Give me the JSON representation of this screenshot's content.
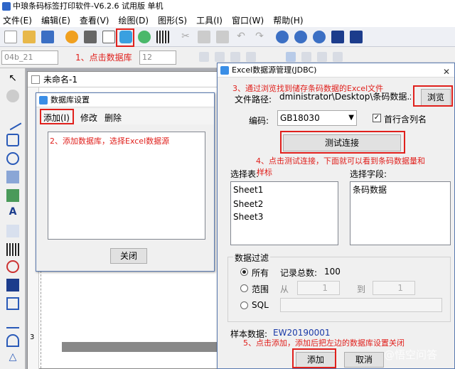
{
  "window": {
    "title": "中琅条码标签打印软件-V6.2.6 试用版 单机"
  },
  "menu": [
    "文件(E)",
    "编辑(E)",
    "查看(V)",
    "绘图(D)",
    "图形(S)",
    "工具(I)",
    "窗口(W)",
    "帮助(H)"
  ],
  "fontbar": {
    "font_name": "04b_21",
    "font_size": "12"
  },
  "document": {
    "tab_title": "未命名-1",
    "ruler_mark": "3"
  },
  "db_settings": {
    "title": "数据库设置",
    "add_label": "添加(I)",
    "modify_label": "修改",
    "delete_label": "删除",
    "close_label": "关闭"
  },
  "excel_dialog": {
    "title": "Excel数据源管理(JDBC)",
    "file_path_label": "文件路径:",
    "file_path_value": "dministrator\\Desktop\\条码数据.xlsx",
    "browse_label": "浏览",
    "encoding_label": "编码:",
    "encoding_value": "GB18030",
    "first_row_label": "首行含列名",
    "test_label": "测试连接",
    "select_table_label": "选择表:",
    "tables": [
      "Sheet1",
      "Sheet2",
      "Sheet3"
    ],
    "select_field_label": "选择字段:",
    "fields": [
      "条码数据"
    ],
    "filter_label": "数据过滤",
    "all_label": "所有",
    "record_count_label": "记录总数:",
    "record_count": "100",
    "range_label": "范围",
    "from_label": "从",
    "from_value": "1",
    "to_label": "到",
    "to_value": "1",
    "sql_label": "SQL",
    "sample_label": "样本数据:",
    "sample_value": "EW20190001",
    "add_label": "添加",
    "cancel_label": "取消"
  },
  "annotations": {
    "step1": "1、点击数据库",
    "step2": "2、添加数据库，选择Excel数据源",
    "step3": "3、通过浏览找到储存条码数据的Excel文件",
    "step4a": "4、点击测试连接，下面就可以看到条码数据量和",
    "step4b": "样标",
    "step5": "5、点击添加，添加后把左边的数据库设置关闭"
  },
  "watermark": "@悟空问答",
  "colors": {
    "annotation_red": "#e0201c",
    "sample_blue": "#1a3aa8",
    "accent_blue": "#3a8ee6"
  }
}
